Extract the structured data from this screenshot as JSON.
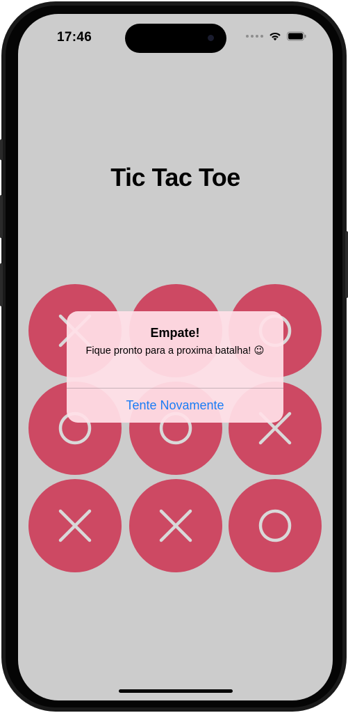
{
  "status_bar": {
    "time": "17:46",
    "icons": [
      "cellular-dots-icon",
      "wifi-icon",
      "battery-icon"
    ]
  },
  "game": {
    "title": "Tic Tac Toe",
    "board": [
      "X",
      "",
      "O",
      "O",
      "O",
      "X",
      "X",
      "X",
      "O"
    ]
  },
  "alert": {
    "title": "Empate!",
    "message": "Fique pronto para a proxima batalha! 😉",
    "button_label": "Tente Novamente"
  },
  "colors": {
    "background": "#cccccc",
    "cell": "#cd4963",
    "mark": "#d9d9d9",
    "alert_button": "#1a7cf5"
  }
}
